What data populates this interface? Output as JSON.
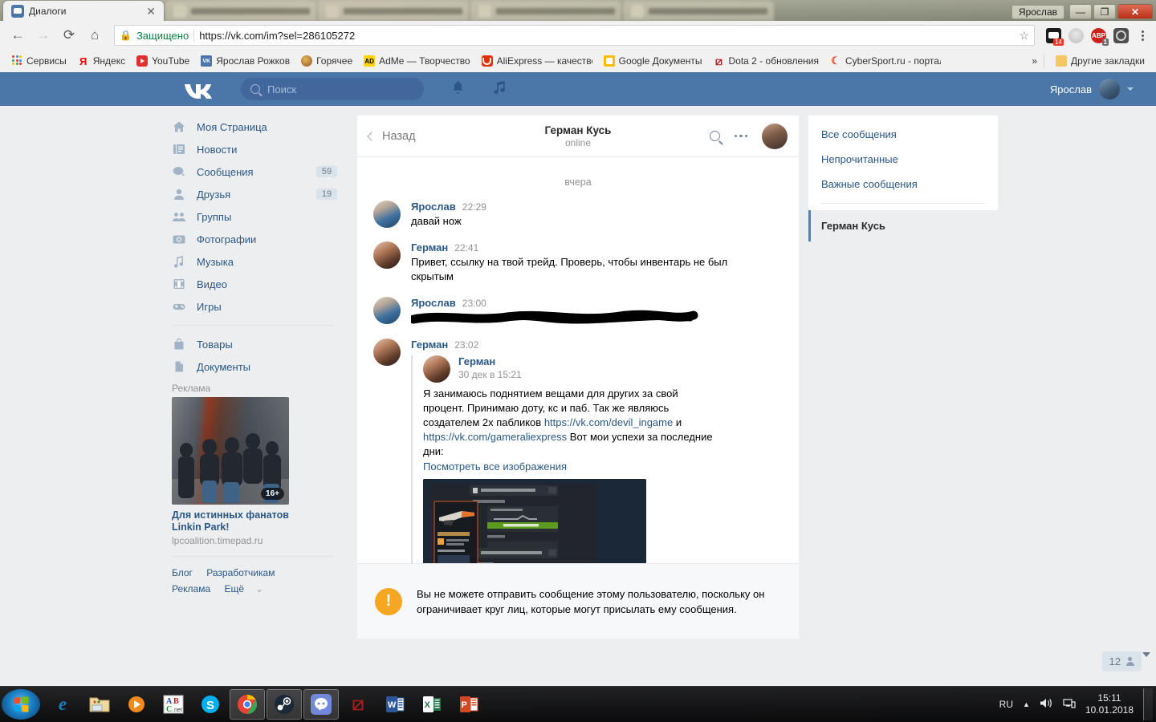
{
  "window": {
    "user_chip": "Ярослав",
    "minimize_label": "—",
    "maximize_label": "❐",
    "close_label": "✕",
    "tabs": [
      {
        "title": "Диалоги",
        "active": true,
        "favicon": "vk-messages-icon"
      },
      {
        "title": "",
        "active": false,
        "favicon": "blurred-icon"
      },
      {
        "title": "",
        "active": false,
        "favicon": "blurred-icon"
      },
      {
        "title": "",
        "active": false,
        "favicon": "blurred-icon"
      },
      {
        "title": "",
        "active": false,
        "favicon": "blurred-icon"
      }
    ]
  },
  "browser": {
    "back_icon": "←",
    "forward_icon": "→",
    "reload_icon": "⟳",
    "home_icon": "⌂",
    "secure_label": "Защищено",
    "url": "https://vk.com/im?sel=286105272",
    "star_icon": "☆",
    "extensions": [
      {
        "name": "vk-helper-extension",
        "badge": "14"
      },
      {
        "name": "globe-extension",
        "badge": ""
      },
      {
        "name": "adblock-plus-extension",
        "badge": "1"
      },
      {
        "name": "lastpass-extension",
        "badge": ""
      }
    ],
    "menu_icon": "⋮",
    "bookmarks": [
      {
        "label": "Сервисы",
        "icon": "apps-grid-icon"
      },
      {
        "label": "Яндекс",
        "icon": "yandex-icon"
      },
      {
        "label": "YouTube",
        "icon": "youtube-icon"
      },
      {
        "label": "Ярослав Рожков",
        "icon": "vk-icon"
      },
      {
        "label": "Горячее",
        "icon": "pikabu-icon"
      },
      {
        "label": "AdMe — Творчество",
        "icon": "adme-icon"
      },
      {
        "label": "AliExpress — качество",
        "icon": "aliexpress-icon"
      },
      {
        "label": "Google Документы",
        "icon": "google-docs-icon"
      },
      {
        "label": "Dota 2 - обновления",
        "icon": "dota2-icon"
      },
      {
        "label": "CyberSport.ru - портал",
        "icon": "cybersport-icon"
      }
    ],
    "overflow_icon": "»",
    "other_bookmarks": "Другие закладки",
    "other_bookmarks_icon": "folder-icon"
  },
  "vk": {
    "logo_text": "VK",
    "search_placeholder": "Поиск",
    "header_icons": [
      {
        "name": "notifications-bell-icon",
        "glyph": "🔔"
      },
      {
        "name": "music-note-icon",
        "glyph": "♫"
      }
    ],
    "account_name": "Ярослав",
    "sidebar": [
      {
        "label": "Моя Страница",
        "icon": "home-icon",
        "badge": ""
      },
      {
        "label": "Новости",
        "icon": "news-icon",
        "badge": ""
      },
      {
        "label": "Сообщения",
        "icon": "messages-icon",
        "badge": "59"
      },
      {
        "label": "Друзья",
        "icon": "friends-icon",
        "badge": "19"
      },
      {
        "label": "Группы",
        "icon": "groups-icon",
        "badge": ""
      },
      {
        "label": "Фотографии",
        "icon": "photos-camera-icon",
        "badge": ""
      },
      {
        "label": "Музыка",
        "icon": "music-icon",
        "badge": ""
      },
      {
        "label": "Видео",
        "icon": "video-icon",
        "badge": ""
      },
      {
        "label": "Игры",
        "icon": "games-gamepad-icon",
        "badge": ""
      }
    ],
    "sidebar_secondary": [
      {
        "label": "Товары",
        "icon": "market-bag-icon",
        "badge": ""
      },
      {
        "label": "Документы",
        "icon": "documents-icon",
        "badge": ""
      }
    ],
    "ads_label": "Реклама",
    "ad": {
      "age_badge": "16+",
      "title": "Для истинных фанатов Linkin Park!",
      "domain": "lpcoalition.timepad.ru"
    },
    "footer_links": [
      "Блог",
      "Разработчикам",
      "Реклама",
      "Ещё"
    ],
    "footer_more_caret": "⌄"
  },
  "conversation": {
    "back_label": "Назад",
    "name": "Герман Кусь",
    "status": "online",
    "date_separator": "вчера",
    "messages": [
      {
        "author": "Ярослав",
        "time": "22:29",
        "avatar": "avatar-yaroslav",
        "text": "давай нож",
        "redacted": false
      },
      {
        "author": "Герман",
        "time": "22:41",
        "avatar": "avatar-german",
        "text": "Привет, ссылку на твой трейд. Проверь, чтобы инвентарь не был скрытым",
        "redacted": false
      },
      {
        "author": "Ярослав",
        "time": "23:00",
        "avatar": "avatar-yaroslav",
        "text": "",
        "redacted": true
      },
      {
        "author": "Герман",
        "time": "23:02",
        "avatar": "avatar-german",
        "text": "",
        "redacted": false,
        "forwarded": {
          "name": "Герман",
          "time": "30 дек в 15:21",
          "text_part1": "Я занимаюсь поднятием вещами для других за свой процент. Принимаю доту, кс и паб. Так же являюсь создателем 2х пабликов ",
          "link1": "https://vk.com/devil_ingame",
          "text_part2": " и ",
          "link2": "https://vk.com/gameraliexpress",
          "text_part3": " Вот мои успехи за последние дни:",
          "show_all": "Посмотреть все изображения",
          "attachment": "steam-trade-screenshot"
        }
      }
    ],
    "notice": {
      "icon": "!",
      "text": "Вы не можете отправить сообщение этому пользователю, поскольку он ограничивает круг лиц, которые могут присылать ему сообщения."
    }
  },
  "right_panel": {
    "items": [
      {
        "label": "Все сообщения",
        "active": false
      },
      {
        "label": "Непрочитанные",
        "active": false
      },
      {
        "label": "Важные сообщения",
        "active": false
      }
    ],
    "selected_dialog": "Герман Кусь"
  },
  "page_counter": {
    "count": "12",
    "icon": "person-icon",
    "caret": "▼"
  },
  "taskbar": {
    "start_icon": "windows-start-icon",
    "items": [
      {
        "name": "internet-explorer-icon",
        "running": false
      },
      {
        "name": "file-explorer-icon",
        "running": false
      },
      {
        "name": "media-player-icon",
        "running": false
      },
      {
        "name": "paint-net-icon",
        "running": false,
        "label": "AB\n.net"
      },
      {
        "name": "skype-icon",
        "running": false,
        "label": "S"
      },
      {
        "name": "google-chrome-icon",
        "running": true
      },
      {
        "name": "steam-icon",
        "running": true
      },
      {
        "name": "discord-icon",
        "running": true
      },
      {
        "name": "dota2-icon",
        "running": false
      },
      {
        "name": "word-icon",
        "running": false,
        "label": "W"
      },
      {
        "name": "excel-icon",
        "running": false,
        "label": "X"
      },
      {
        "name": "powerpoint-icon",
        "running": false,
        "label": "P"
      }
    ],
    "tray": {
      "language": "RU",
      "show_hidden_icon": "▲",
      "volume_icon": "🔊",
      "network_icon": "network-icon",
      "time": "15:11",
      "date": "10.01.2018"
    }
  },
  "colors": {
    "vk_blue": "#4a76a8",
    "vk_link": "#2a5885",
    "page_bg": "#edeef0",
    "warning": "#f5a623"
  }
}
